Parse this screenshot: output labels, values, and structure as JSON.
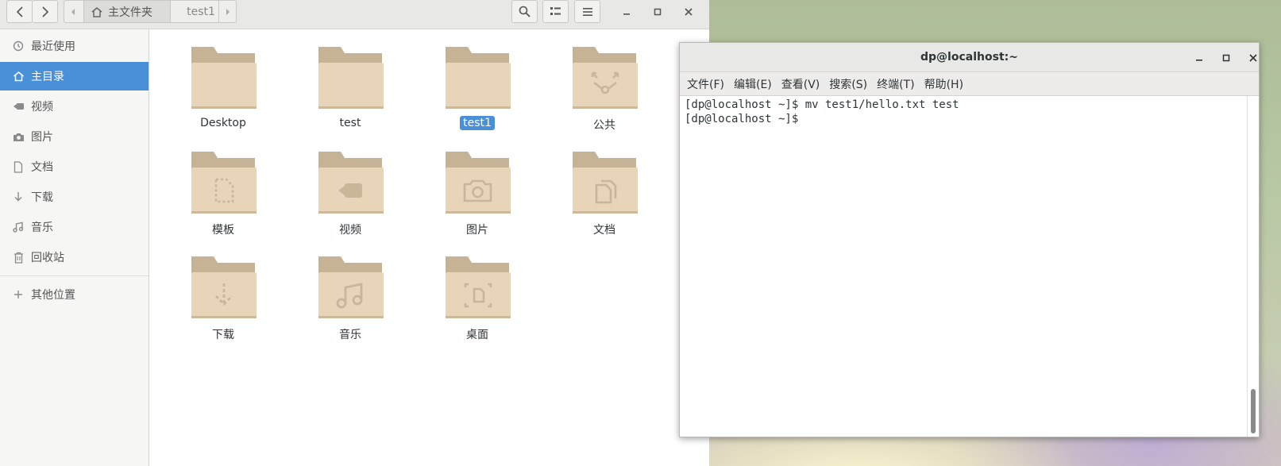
{
  "file_manager": {
    "path": {
      "home_label": "主文件夹",
      "current_label": "test1"
    },
    "sidebar": {
      "items": [
        {
          "label": "最近使用",
          "icon": "clock-icon",
          "active": false
        },
        {
          "label": "主目录",
          "icon": "home-icon",
          "active": true
        },
        {
          "label": "视频",
          "icon": "video-icon",
          "active": false
        },
        {
          "label": "图片",
          "icon": "camera-icon",
          "active": false
        },
        {
          "label": "文档",
          "icon": "document-icon",
          "active": false
        },
        {
          "label": "下载",
          "icon": "download-icon",
          "active": false
        },
        {
          "label": "音乐",
          "icon": "music-icon",
          "active": false
        },
        {
          "label": "回收站",
          "icon": "trash-icon",
          "active": false
        }
      ],
      "other_locations": {
        "label": "其他位置",
        "icon": "plus-icon"
      }
    },
    "folders": [
      {
        "label": "Desktop",
        "emblem": "none",
        "selected": false
      },
      {
        "label": "test",
        "emblem": "none",
        "selected": false
      },
      {
        "label": "test1",
        "emblem": "none",
        "selected": true
      },
      {
        "label": "公共",
        "emblem": "share-icon",
        "selected": false
      },
      {
        "label": "模板",
        "emblem": "template-icon",
        "selected": false
      },
      {
        "label": "视频",
        "emblem": "video-icon",
        "selected": false
      },
      {
        "label": "图片",
        "emblem": "camera-icon",
        "selected": false
      },
      {
        "label": "文档",
        "emblem": "documents-icon",
        "selected": false
      },
      {
        "label": "下载",
        "emblem": "download-icon",
        "selected": false
      },
      {
        "label": "音乐",
        "emblem": "music-icon",
        "selected": false
      },
      {
        "label": "桌面",
        "emblem": "desktop-icon",
        "selected": false
      }
    ]
  },
  "terminal": {
    "title": "dp@localhost:~",
    "menu": [
      "文件(F)",
      "编辑(E)",
      "查看(V)",
      "搜索(S)",
      "终端(T)",
      "帮助(H)"
    ],
    "lines": [
      "[dp@localhost ~]$ mv test1/hello.txt test",
      "[dp@localhost ~]$ "
    ]
  },
  "colors": {
    "accent": "#4a90d9",
    "folder_body": "#e8d4b8",
    "folder_tab": "#c6b396"
  }
}
